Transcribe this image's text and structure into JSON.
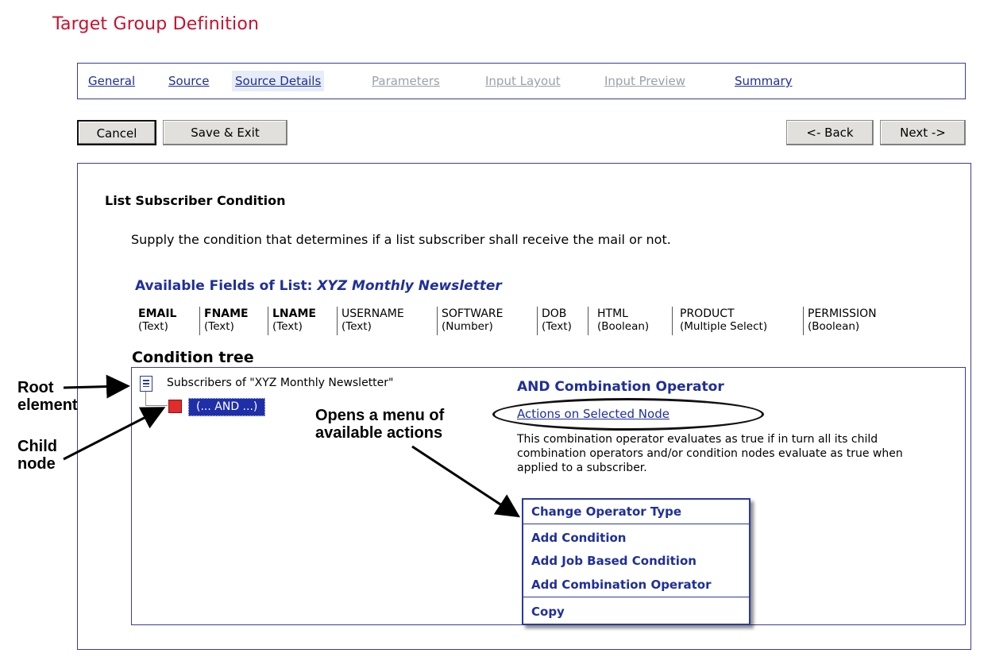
{
  "page_title": "Target Group Definition",
  "tabs": [
    {
      "label": "General",
      "state": "active"
    },
    {
      "label": "Source",
      "state": "active"
    },
    {
      "label": "Source Details",
      "state": "current"
    },
    {
      "label": "Parameters",
      "state": "disabled"
    },
    {
      "label": "Input Layout",
      "state": "disabled"
    },
    {
      "label": "Input Preview",
      "state": "disabled"
    },
    {
      "label": "Summary",
      "state": "active"
    }
  ],
  "buttons": {
    "cancel": "Cancel",
    "save_exit": "Save & Exit",
    "back": "<- Back",
    "next": "Next ->"
  },
  "section": {
    "title": "List Subscriber Condition",
    "description": "Supply the condition that determines if a list subscriber shall receive the mail or not.",
    "fields_title_prefix": "Available Fields of List:",
    "fields_title_list": "XYZ Monthly Newsletter"
  },
  "fields": [
    {
      "name": "EMAIL",
      "type": "(Text)",
      "bold": true
    },
    {
      "name": "FNAME",
      "type": "(Text)",
      "bold": true
    },
    {
      "name": "LNAME",
      "type": "(Text)",
      "bold": true
    },
    {
      "name": "USERNAME",
      "type": "(Text)",
      "bold": false
    },
    {
      "name": "SOFTWARE",
      "type": "(Number)",
      "bold": false
    },
    {
      "name": "DOB",
      "type": "(Text)",
      "bold": false
    },
    {
      "name": "HTML",
      "type": "(Boolean)",
      "bold": false
    },
    {
      "name": "PRODUCT",
      "type": "(Multiple Select)",
      "bold": false
    },
    {
      "name": "PERMISSION",
      "type": "(Boolean)",
      "bold": false
    }
  ],
  "condition_tree": {
    "label": "Condition tree",
    "root_text": "Subscribers of \"XYZ Monthly Newsletter\"",
    "child_node": "(... AND ...)",
    "icons": {
      "root": "document-icon",
      "child": "red-square-icon"
    }
  },
  "operator_panel": {
    "title": "AND Combination Operator",
    "actions_link": "Actions on Selected Node",
    "description": "This combination operator evaluates as true if in turn all its child combination operators and/or condition nodes evaluate as true when applied to a subscriber."
  },
  "menu": {
    "items": [
      "Change Operator Type",
      "Add Condition",
      "Add Job Based Condition",
      "Add Combination Operator",
      "Copy"
    ]
  },
  "annotations": {
    "root_element": "Root\nelement",
    "child_node": "Child\nnode",
    "opens_menu": "Opens a menu of\navailable actions"
  },
  "colors": {
    "title_red": "#c8102e",
    "link_blue": "#1f2f9a",
    "selected_node_bg": "#1f2fa8",
    "panel_border": "#3b3b9a"
  }
}
